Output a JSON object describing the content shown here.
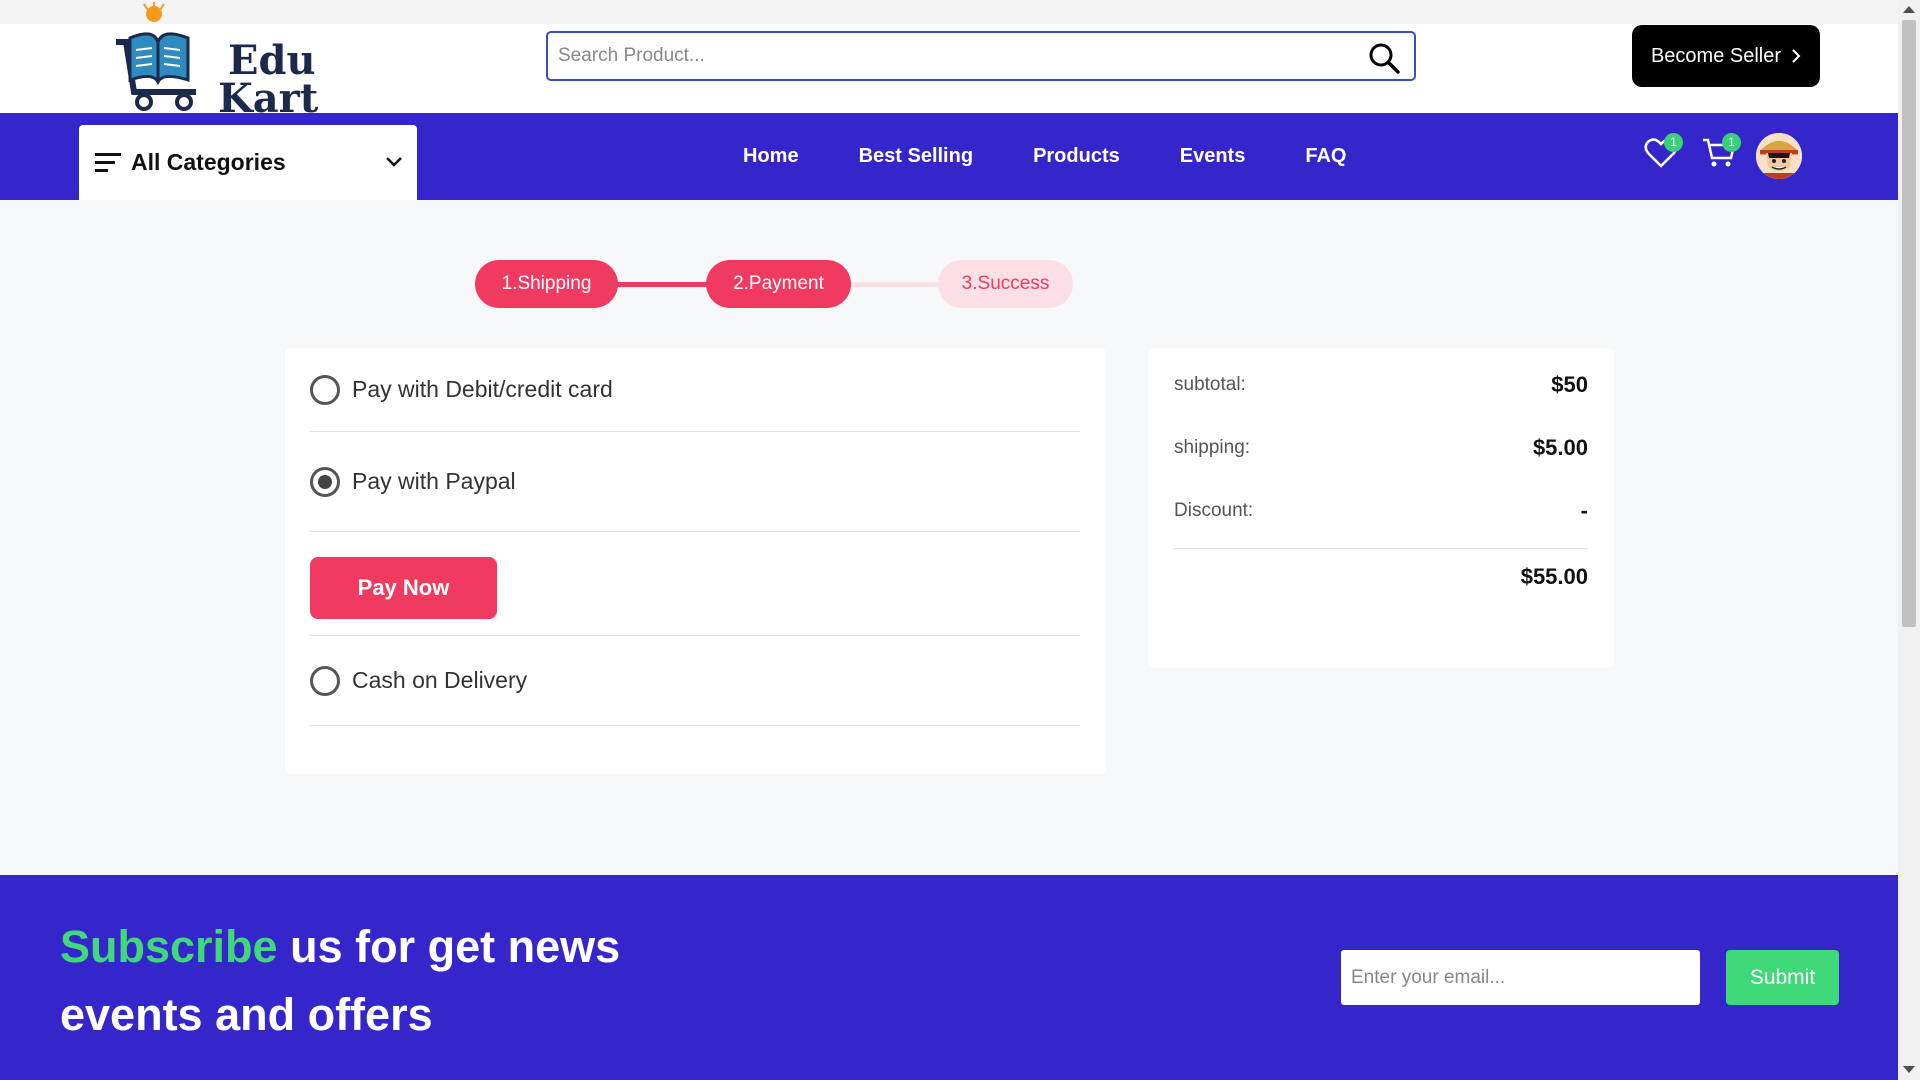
{
  "header": {
    "logo_line1": "Edu",
    "logo_line2": "Kart",
    "search_placeholder": "Search Product...",
    "become_seller_label": "Become Seller"
  },
  "nav": {
    "categories_label": "All Categories",
    "links": [
      "Home",
      "Best Selling",
      "Products",
      "Events",
      "FAQ"
    ],
    "wishlist_count": "1",
    "cart_count": "1"
  },
  "steps": [
    {
      "label": "1.Shipping",
      "state": "active"
    },
    {
      "label": "2.Payment",
      "state": "active"
    },
    {
      "label": "3.Success",
      "state": "pending"
    }
  ],
  "payment": {
    "options": [
      {
        "label": "Pay with Debit/credit card",
        "selected": false
      },
      {
        "label": "Pay with Paypal",
        "selected": true
      },
      {
        "label": "Cash on Delivery",
        "selected": false
      }
    ],
    "pay_now_label": "Pay Now"
  },
  "summary": {
    "subtotal_label": "subtotal:",
    "subtotal_value": "$50",
    "shipping_label": "shipping:",
    "shipping_value": "$5.00",
    "discount_label": "Discount:",
    "discount_value": "-",
    "total_value": "$55.00"
  },
  "footer": {
    "subscribe_accent": "Subscribe",
    "subscribe_rest": " us for get news events and offers",
    "email_placeholder": "Enter your email...",
    "submit_label": "Submit"
  },
  "colors": {
    "brand": "#3526cc",
    "accent_pink": "#f03a5f",
    "accent_green": "#3fd97a"
  }
}
